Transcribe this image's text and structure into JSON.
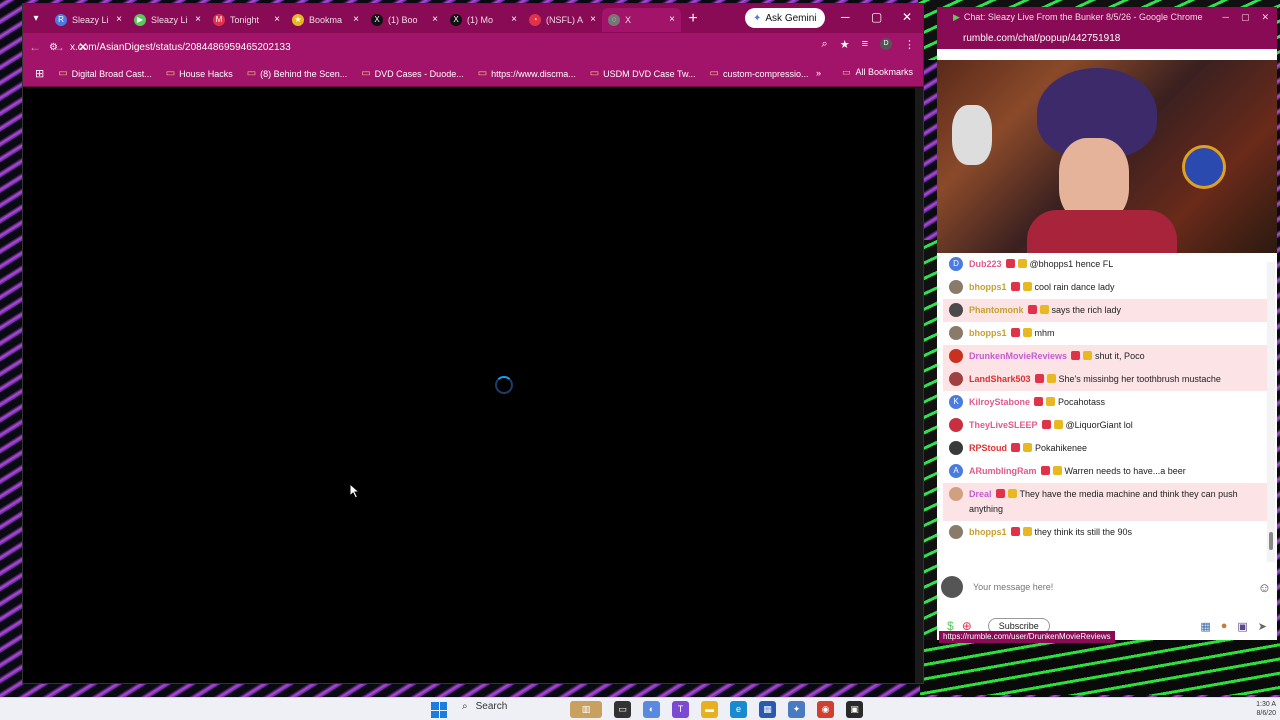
{
  "browser": {
    "tabs": [
      {
        "label": "Sleazy Li",
        "color": "#4a7be0",
        "glyph": "R"
      },
      {
        "label": "Sleazy Li",
        "color": "#5ac85a",
        "glyph": "▶"
      },
      {
        "label": "Tonight",
        "color": "#e0334a",
        "glyph": "M"
      },
      {
        "label": "Bookma",
        "color": "#e8b820",
        "glyph": "★"
      },
      {
        "label": "(1) Boo",
        "color": "#111111",
        "glyph": "X"
      },
      {
        "label": "(1) Mo",
        "color": "#111111",
        "glyph": "X"
      },
      {
        "label": "(NSFL) A",
        "color": "#e0334a",
        "glyph": "◔"
      },
      {
        "label": "X",
        "color": "#777777",
        "glyph": "◌"
      }
    ],
    "gemini_label": "Ask Gemini",
    "url": "x.com/AsianDigest/status/2084486959465202133",
    "bookmarks": [
      "Digital Broad Cast...",
      "House Hacks",
      "(8) Behind the Scen...",
      "DVD Cases - Duode...",
      "https://www.discma...",
      "USDM DVD Case Tw...",
      "custom-compressio..."
    ],
    "all_bookmarks": "All Bookmarks"
  },
  "chat": {
    "window_title": "Chat: Sleazy Live From the Bunker 8/5/26 - Google Chrome",
    "url": "rumble.com/chat/popup/442751918",
    "messages": [
      {
        "user": "Dub223",
        "color": "#e05a8a",
        "avatar": "D",
        "avcolor": "#4a7be0",
        "text": "@bhopps1 hence FL",
        "hl": false
      },
      {
        "user": "bhopps1",
        "color": "#c8a030",
        "avatar": "",
        "avcolor": "#8a7a6a",
        "text": "cool rain dance lady",
        "hl": false
      },
      {
        "user": "Phantomonk",
        "color": "#c8a030",
        "avatar": "",
        "avcolor": "#4a4a4a",
        "text": "says the rich lady",
        "hl": true
      },
      {
        "user": "bhopps1",
        "color": "#c8a030",
        "avatar": "",
        "avcolor": "#8a7a6a",
        "text": "mhm",
        "hl": false
      },
      {
        "user": "DrunkenMovieReviews",
        "color": "#c85ad0",
        "avatar": "",
        "avcolor": "#c83020",
        "text": "shut it, Poco",
        "hl": true
      },
      {
        "user": "LandShark503",
        "color": "#e03030",
        "avatar": "",
        "avcolor": "#a04040",
        "text": "She's missinbg her toothbrush mustache",
        "hl": true
      },
      {
        "user": "KilroyStabone",
        "color": "#e05a8a",
        "avatar": "K",
        "avcolor": "#4a7be0",
        "text": "Pocahotass",
        "hl": false
      },
      {
        "user": "TheyLiveSLEEP",
        "color": "#e05a8a",
        "avatar": "",
        "avcolor": "#c83040",
        "text": "@LiquorGiant lol",
        "hl": false
      },
      {
        "user": "RPStoud",
        "color": "#e03030",
        "avatar": "",
        "avcolor": "#3a3a3a",
        "text": "Pokahikenee",
        "hl": false
      },
      {
        "user": "ARumblingRam",
        "color": "#e05a8a",
        "avatar": "A",
        "avcolor": "#4a7be0",
        "text": "Warren needs to have...a beer",
        "hl": false
      },
      {
        "user": "Dreal",
        "color": "#c85ad0",
        "avatar": "",
        "avcolor": "#d0a080",
        "text": "They have the media machine and think they can push anything",
        "hl": true
      },
      {
        "user": "bhopps1",
        "color": "#c8a030",
        "avatar": "",
        "avcolor": "#8a7a6a",
        "text": "they think its still the 90s",
        "hl": false
      }
    ],
    "input_placeholder": "Your message here!",
    "subscribe_label": "Subscribe",
    "status_link": "https://rumble.com/user/DrunkenMovieReviews"
  },
  "taskbar": {
    "search_label": "Search",
    "time": "1:30 A",
    "date": "8/6/20"
  }
}
